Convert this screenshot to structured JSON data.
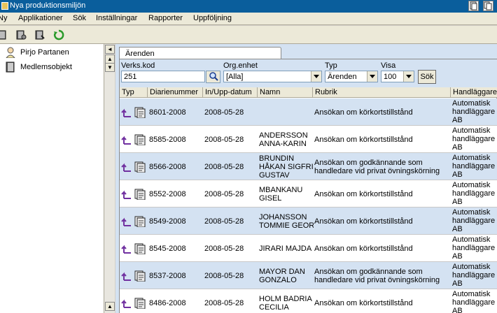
{
  "window": {
    "title": "Nya produktionsmiljön"
  },
  "menu": [
    "Ny",
    "Applikationer",
    "Sök",
    "Inställningar",
    "Rapporter",
    "Uppföljning"
  ],
  "toolbar": {
    "icons": [
      "book-icon",
      "book-tools-icon",
      "book-search-icon",
      "refresh-icon"
    ]
  },
  "tree": {
    "items": [
      {
        "label": "Pirjo Partanen",
        "icon": "person-icon"
      },
      {
        "label": "Medlemsobjekt",
        "icon": "book-icon"
      }
    ]
  },
  "tab": {
    "label": "Ärenden"
  },
  "filters": {
    "verkskod_label": "Verks.kod",
    "verkskod_value": "251",
    "orgenhet_label": "Org.enhet",
    "orgenhet_value": "[Alla]",
    "typ_label": "Typ",
    "typ_value": "Ärenden",
    "visa_label": "Visa",
    "visa_value": "100",
    "search_label": "Sök"
  },
  "grid": {
    "columns": [
      "Typ",
      "Diarienummer",
      "In/Upp-datum",
      "Namn",
      "Rubrik",
      "Handläggare"
    ],
    "rows": [
      {
        "diarienummer": "8601-2008",
        "datum": "2008-05-28",
        "namn1": "",
        "namn2": "",
        "namn3": "",
        "rubrik1": "Ansökan om körkortstillstånd",
        "rubrik2": "",
        "hand1": "Automatisk",
        "hand2": "handläggare",
        "hand3": "AB"
      },
      {
        "diarienummer": "8585-2008",
        "datum": "2008-05-28",
        "namn1": "ANDERSSON",
        "namn2": "ANNA-KARIN",
        "namn3": "",
        "rubrik1": "Ansökan om körkortstillstånd",
        "rubrik2": "",
        "hand1": "Automatisk",
        "hand2": "handläggare",
        "hand3": "AB"
      },
      {
        "diarienummer": "8566-2008",
        "datum": "2008-05-28",
        "namn1": "BRUNDIN",
        "namn2": "HÅKAN SIGFRID",
        "namn3": "GUSTAV",
        "rubrik1": "Ansökan om godkännande som",
        "rubrik2": "handledare vid privat övningskörning",
        "hand1": "Automatisk",
        "hand2": "handläggare",
        "hand3": "AB"
      },
      {
        "diarienummer": "8552-2008",
        "datum": "2008-05-28",
        "namn1": "MBANKANU",
        "namn2": "GISEL",
        "namn3": "",
        "rubrik1": "Ansökan om körkortstillstånd",
        "rubrik2": "",
        "hand1": "Automatisk",
        "hand2": "handläggare",
        "hand3": "AB"
      },
      {
        "diarienummer": "8549-2008",
        "datum": "2008-05-28",
        "namn1": "JOHANSSON",
        "namn2": "TOMMIE GEORG",
        "namn3": "",
        "rubrik1": "Ansökan om körkortstillstånd",
        "rubrik2": "",
        "hand1": "Automatisk",
        "hand2": "handläggare",
        "hand3": "AB"
      },
      {
        "diarienummer": "8545-2008",
        "datum": "2008-05-28",
        "namn1": "JIRARI MAJDA",
        "namn2": "",
        "namn3": "",
        "rubrik1": "Ansökan om körkortstillstånd",
        "rubrik2": "",
        "hand1": "Automatisk",
        "hand2": "handläggare",
        "hand3": "AB"
      },
      {
        "diarienummer": "8537-2008",
        "datum": "2008-05-28",
        "namn1": "MAYOR DAN",
        "namn2": "GONZALO",
        "namn3": "",
        "rubrik1": "Ansökan om godkännande som",
        "rubrik2": "handledare vid privat övningskörning",
        "hand1": "Automatisk",
        "hand2": "handläggare",
        "hand3": "AB"
      },
      {
        "diarienummer": "8486-2008",
        "datum": "2008-05-28",
        "namn1": "HOLM BADRIA",
        "namn2": "CECILIA",
        "namn3": "",
        "rubrik1": "Ansökan om körkortstillstånd",
        "rubrik2": "",
        "hand1": "Automatisk",
        "hand2": "handläggare",
        "hand3": "AB"
      }
    ]
  },
  "colors": {
    "titlebar": "#0a5e9c",
    "row_alt": "#d4e2f2",
    "icon_purple": "#7030a0"
  }
}
